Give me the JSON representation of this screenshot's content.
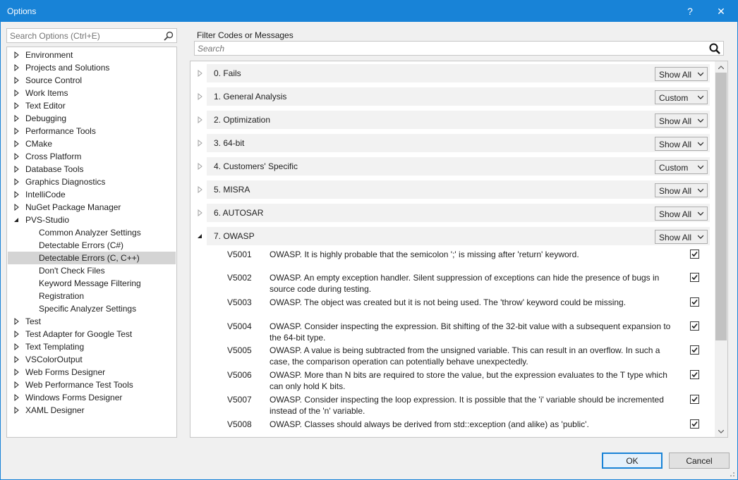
{
  "window": {
    "title": "Options",
    "help_glyph": "?",
    "close_glyph": "✕"
  },
  "search": {
    "placeholder": "Search Options (Ctrl+E)"
  },
  "tree": {
    "items": [
      {
        "label": "Environment",
        "level": 0,
        "expanded": false
      },
      {
        "label": "Projects and Solutions",
        "level": 0,
        "expanded": false
      },
      {
        "label": "Source Control",
        "level": 0,
        "expanded": false
      },
      {
        "label": "Work Items",
        "level": 0,
        "expanded": false
      },
      {
        "label": "Text Editor",
        "level": 0,
        "expanded": false
      },
      {
        "label": "Debugging",
        "level": 0,
        "expanded": false
      },
      {
        "label": "Performance Tools",
        "level": 0,
        "expanded": false
      },
      {
        "label": "CMake",
        "level": 0,
        "expanded": false
      },
      {
        "label": "Cross Platform",
        "level": 0,
        "expanded": false
      },
      {
        "label": "Database Tools",
        "level": 0,
        "expanded": false
      },
      {
        "label": "Graphics Diagnostics",
        "level": 0,
        "expanded": false
      },
      {
        "label": "IntelliCode",
        "level": 0,
        "expanded": false
      },
      {
        "label": "NuGet Package Manager",
        "level": 0,
        "expanded": false
      },
      {
        "label": "PVS-Studio",
        "level": 0,
        "expanded": true
      },
      {
        "label": "Common Analyzer Settings",
        "level": 1
      },
      {
        "label": "Detectable Errors (C#)",
        "level": 1
      },
      {
        "label": "Detectable Errors (C, C++)",
        "level": 1,
        "selected": true
      },
      {
        "label": "Don't Check Files",
        "level": 1
      },
      {
        "label": "Keyword Message Filtering",
        "level": 1
      },
      {
        "label": "Registration",
        "level": 1
      },
      {
        "label": "Specific Analyzer Settings",
        "level": 1
      },
      {
        "label": "Test",
        "level": 0,
        "expanded": false
      },
      {
        "label": "Test Adapter for Google Test",
        "level": 0,
        "expanded": false
      },
      {
        "label": "Text Templating",
        "level": 0,
        "expanded": false
      },
      {
        "label": "VSColorOutput",
        "level": 0,
        "expanded": false
      },
      {
        "label": "Web Forms Designer",
        "level": 0,
        "expanded": false
      },
      {
        "label": "Web Performance Test Tools",
        "level": 0,
        "expanded": false
      },
      {
        "label": "Windows Forms Designer",
        "level": 0,
        "expanded": false
      },
      {
        "label": "XAML Designer",
        "level": 0,
        "expanded": false
      }
    ]
  },
  "filter": {
    "label": "Filter Codes or Messages",
    "placeholder": "Search"
  },
  "groups": [
    {
      "label": "0. Fails",
      "mode": "Show All",
      "expanded": false
    },
    {
      "label": "1. General Analysis",
      "mode": "Custom",
      "expanded": false
    },
    {
      "label": "2. Optimization",
      "mode": "Show All",
      "expanded": false
    },
    {
      "label": "3. 64-bit",
      "mode": "Show All",
      "expanded": false
    },
    {
      "label": "4. Customers' Specific",
      "mode": "Custom",
      "expanded": false
    },
    {
      "label": "5. MISRA",
      "mode": "Show All",
      "expanded": false
    },
    {
      "label": "6. AUTOSAR",
      "mode": "Show All",
      "expanded": false
    },
    {
      "label": "7. OWASP",
      "mode": "Show All",
      "expanded": true
    }
  ],
  "rules": [
    {
      "code": "V5001",
      "message": "OWASP. It is highly probable that the semicolon ';' is missing after 'return' keyword.",
      "checked": true
    },
    {
      "code": "V5002",
      "message": "OWASP. An empty exception handler. Silent suppression of exceptions can hide the presence of bugs in source code during testing.",
      "checked": true
    },
    {
      "code": "V5003",
      "message": "OWASP. The object was created but it is not being used. The 'throw' keyword could be missing.",
      "checked": true
    },
    {
      "code": "V5004",
      "message": "OWASP. Consider inspecting the expression. Bit shifting of the 32-bit value with a subsequent expansion to the 64-bit type.",
      "checked": true
    },
    {
      "code": "V5005",
      "message": "OWASP. A value is being subtracted from the unsigned variable. This can result in an overflow. In such a case, the comparison operation can potentially behave unexpectedly.",
      "checked": true
    },
    {
      "code": "V5006",
      "message": "OWASP. More than N bits are required to store the value, but the expression evaluates to the T type which can only hold K bits.",
      "checked": true
    },
    {
      "code": "V5007",
      "message": "OWASP. Consider inspecting the loop expression. It is possible that the 'i' variable should be incremented instead of the 'n' variable.",
      "checked": true
    },
    {
      "code": "V5008",
      "message": "OWASP. Classes should always be derived from std::exception (and alike) as 'public'.",
      "checked": true
    }
  ],
  "buttons": {
    "ok": "OK",
    "cancel": "Cancel"
  },
  "colors": {
    "accent": "#1883d7",
    "selection": "#d4d4d4"
  }
}
